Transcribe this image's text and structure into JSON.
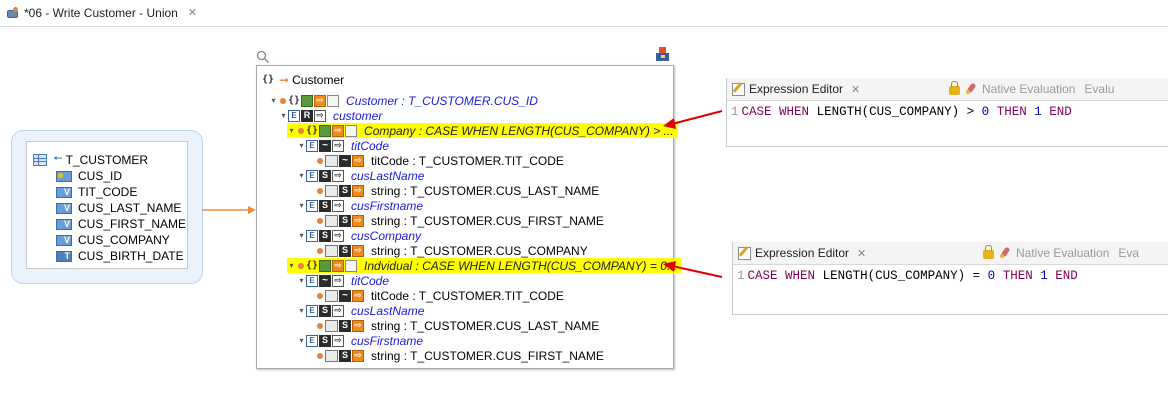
{
  "editor_tab": {
    "title": "*06 - Write Customer - Union",
    "close": "✕"
  },
  "source_table": {
    "name": "T_CUSTOMER",
    "columns": [
      {
        "name": "CUS_ID",
        "badge": "",
        "key": true
      },
      {
        "name": "TIT_CODE",
        "badge": "V",
        "key": false
      },
      {
        "name": "CUS_LAST_NAME",
        "badge": "V",
        "key": false
      },
      {
        "name": "CUS_FIRST_NAME",
        "badge": "V",
        "key": false
      },
      {
        "name": "CUS_COMPANY",
        "badge": "V",
        "key": false
      },
      {
        "name": "CUS_BIRTH_DATE",
        "badge": "T",
        "key": false
      }
    ]
  },
  "tree": {
    "root": "Customer",
    "customer_node": "Customer : T_CUSTOMER.CUS_ID",
    "customer_sub": "customer",
    "company": {
      "label": "Company : CASE WHEN LENGTH(CUS_COMPANY) > ...",
      "titcode": "titCode",
      "titcode_map": "titCode : T_CUSTOMER.TIT_CODE",
      "lastname": "cusLastName",
      "lastname_map": "string : T_CUSTOMER.CUS_LAST_NAME",
      "firstname": "cusFirstname",
      "firstname_map": "string : T_CUSTOMER.CUS_FIRST_NAME",
      "company": "cusCompany",
      "company_map": "string : T_CUSTOMER.CUS_COMPANY"
    },
    "individual": {
      "label": "Indvidual : CASE WHEN LENGTH(CUS_COMPANY) = 0...",
      "titcode": "titCode",
      "titcode_map": "titCode : T_CUSTOMER.TIT_CODE",
      "lastname": "cusLastName",
      "lastname_map": "string : T_CUSTOMER.CUS_LAST_NAME",
      "firstname": "cusFirstname",
      "firstname_map": "string : T_CUSTOMER.CUS_FIRST_NAME"
    },
    "icons": {
      "braces": "{}",
      "E": "E",
      "R": "R",
      "S": "S",
      "T": "T",
      "V": "V",
      "tilde": "~",
      "twisty": "▾",
      "orange_arrow": "➞",
      "out_arrow": "⇨"
    }
  },
  "expr1": {
    "title": "Expression Editor",
    "tool": "Native Evaluation",
    "tool2": "Evalu",
    "line_no": "1",
    "kw_case": "CASE",
    "kw_when": "WHEN",
    "fn": "LENGTH",
    "arg": "(CUS_COMPANY)",
    "op": ">",
    "zero": "0",
    "kw_then": "THEN",
    "one": "1",
    "kw_end": "END"
  },
  "expr2": {
    "title": "Expression Editor",
    "tool": "Native Evaluation",
    "tool2": "Eva",
    "line_no": "1",
    "kw_case": "CASE",
    "kw_when": "WHEN",
    "fn": "LENGTH",
    "arg": "(CUS_COMPANY)",
    "op": "=",
    "zero": "0",
    "kw_then": "THEN",
    "one": "1",
    "kw_end": "END"
  },
  "colors": {
    "highlight": "#ffff00",
    "arrow_red": "#e00000",
    "connector": "#f08a3a",
    "link_blue": "#1a1ae0"
  }
}
